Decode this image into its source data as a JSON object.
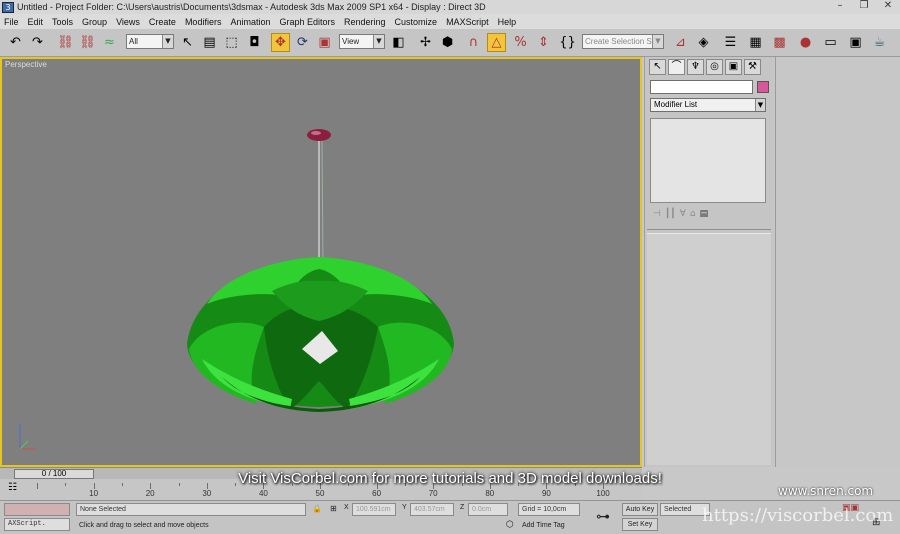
{
  "window": {
    "title": "Untitled    - Project Folder: C:\\Users\\austris\\Documents\\3dsmax    - Autodesk 3ds Max  2009 SP1  x64       - Display : Direct 3D",
    "controls": [
      "–",
      "❐",
      "✕"
    ]
  },
  "menu": [
    "File",
    "Edit",
    "Tools",
    "Group",
    "Views",
    "Create",
    "Modifiers",
    "Animation",
    "Graph Editors",
    "Rendering",
    "Customize",
    "MAXScript",
    "Help"
  ],
  "toolbar": {
    "selection_filter": "All",
    "reference_coord": "View",
    "named_selection_placeholder": "Create Selection Set",
    "active_tool": "select-and-move"
  },
  "viewport": {
    "label": "Perspective",
    "border_color": "#e5c51f",
    "object_color": "#1fae1f",
    "background": "#7f7f7f"
  },
  "command_panel": {
    "tab_icons": [
      "create",
      "modify",
      "hierarchy",
      "motion",
      "display",
      "utilities"
    ],
    "modifier_list": "Modifier List",
    "object_color": "#d9569a"
  },
  "timeline": {
    "frame_display": "0 / 100",
    "ticks": [
      "10",
      "20",
      "30",
      "40",
      "50",
      "60",
      "70",
      "80",
      "90",
      "100"
    ]
  },
  "status": {
    "maxscript_label": "AXScript.",
    "selection": "None Selected",
    "prompt": "Click and drag to select and move objects",
    "x_value": "100.591cm",
    "y_value": "403.57cm",
    "z_value": "0.0cm",
    "grid": "Grid = 10,0cm",
    "add_time_tag": "Add Time Tag",
    "auto_key": "Auto Key",
    "set_key": "Set Key",
    "key_filter": "Selected",
    "x_label": "X",
    "y_label": "Y",
    "z_label": "Z"
  },
  "overlay": {
    "caption": "Visit VisCorbel.com for more tutorials and 3D model downloads!",
    "watermark_site": "www.snren.com",
    "watermark_url": "https://viscorbel.com"
  }
}
